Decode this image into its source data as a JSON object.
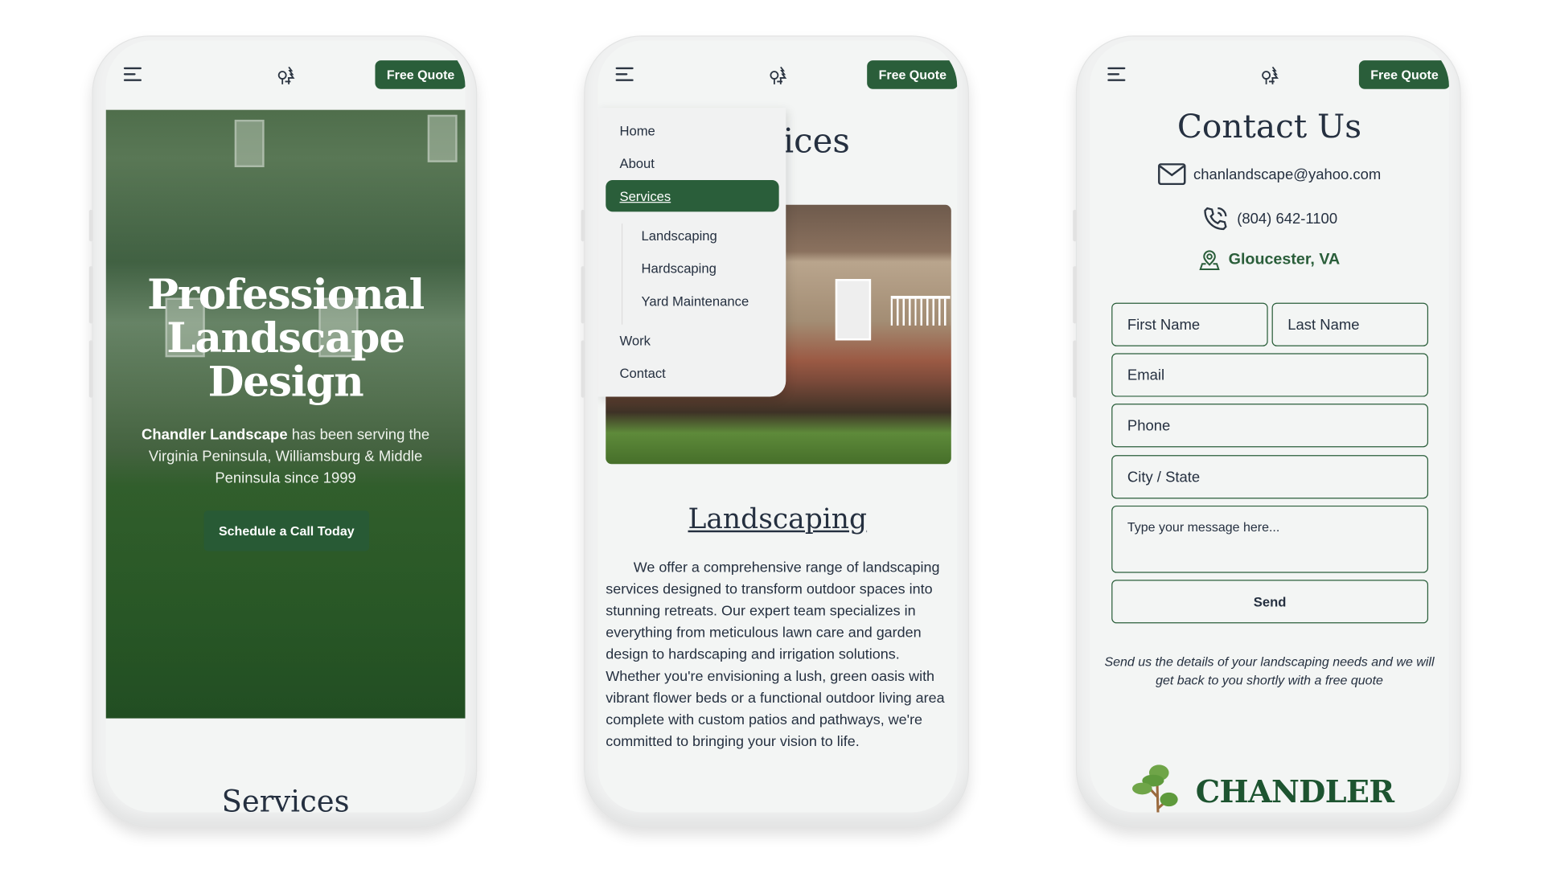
{
  "header": {
    "free_quote": "Free Quote",
    "logo_icon": "trees-icon",
    "menu_icon": "hamburger-icon"
  },
  "colors": {
    "brand_green": "#2a5e3a",
    "text": "#253040",
    "background": "#f3f5f4"
  },
  "home": {
    "title_lines": [
      "Professional",
      "Landscape",
      "Design"
    ],
    "intro_bold": "Chandler Landscape",
    "intro_rest": " has been serving the Virginia Peninsula, Williamsburg & Middle Peninsula since 1999",
    "cta": "Schedule a Call Today",
    "next_section": "Services"
  },
  "services": {
    "title": "Services",
    "menu": {
      "items": [
        "Home",
        "About",
        "Services"
      ],
      "sub_items": [
        "Landscaping",
        "Hardscaping",
        "Yard Maintenance"
      ],
      "more_items": [
        "Work",
        "Contact"
      ],
      "active": "Services"
    },
    "heading": "Landscaping",
    "body": "We offer a comprehensive range of landscaping services designed to transform outdoor spaces into stunning retreats. Our expert team specializes in everything from meticulous lawn care and garden design to hardscaping and irrigation solutions. Whether you're envisioning a lush, green oasis with vibrant flower beds or a functional outdoor living area complete with custom patios and pathways, we're committed to bringing your vision to life."
  },
  "contact": {
    "title": "Contact Us",
    "email": "chanlandscape@yahoo.com",
    "phone": "(804) 642-1100",
    "location": "Gloucester, VA",
    "form": {
      "first_name": "First Name",
      "last_name": "Last Name",
      "email": "Email",
      "phone": "Phone",
      "city_state": "City / State",
      "message": "Type your message here...",
      "send": "Send"
    },
    "note": "Send us the details of your landscaping needs and we will get back to you shortly with a free quote",
    "brand": "CHANDLER"
  }
}
